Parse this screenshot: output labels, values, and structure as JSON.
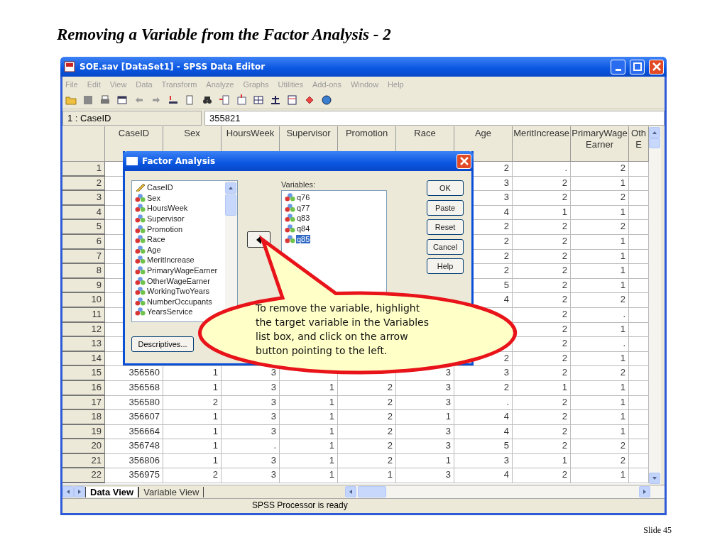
{
  "slide": {
    "title": "Removing a Variable from the Factor Analysis - 2",
    "footer": "Slide 45"
  },
  "window": {
    "title": "SOE.sav [DataSet1] - SPSS Data Editor"
  },
  "menu": [
    "File",
    "Edit",
    "View",
    "Data",
    "Transform",
    "Analyze",
    "Graphs",
    "Utilities",
    "Add-ons",
    "Window",
    "Help"
  ],
  "cell_editor": {
    "cell": "1 : CaseID",
    "value": "355821"
  },
  "table": {
    "columns": [
      "CaseID",
      "Sex",
      "HoursWeek",
      "Supervisor",
      "Promotion",
      "Race",
      "Age",
      "MeritIncrease",
      "PrimaryWageEarner",
      "Oth E"
    ],
    "rows": [
      {
        "number": "1",
        "cells": [
          null,
          null,
          null,
          null,
          null,
          null,
          "2",
          ".",
          "2"
        ]
      },
      {
        "number": "2",
        "cells": [
          null,
          null,
          null,
          null,
          null,
          null,
          "3",
          "2",
          "1"
        ]
      },
      {
        "number": "3",
        "cells": [
          null,
          null,
          null,
          null,
          null,
          null,
          "3",
          "2",
          "2"
        ]
      },
      {
        "number": "4",
        "cells": [
          null,
          null,
          null,
          null,
          null,
          null,
          "4",
          "1",
          "1"
        ]
      },
      {
        "number": "5",
        "cells": [
          null,
          null,
          null,
          null,
          null,
          null,
          "2",
          "2",
          "2"
        ]
      },
      {
        "number": "6",
        "cells": [
          null,
          null,
          null,
          null,
          null,
          null,
          "2",
          "2",
          "1"
        ]
      },
      {
        "number": "7",
        "cells": [
          null,
          null,
          null,
          null,
          null,
          null,
          "2",
          "2",
          "1"
        ]
      },
      {
        "number": "8",
        "cells": [
          null,
          null,
          null,
          null,
          null,
          null,
          "2",
          "2",
          "1"
        ]
      },
      {
        "number": "9",
        "cells": [
          null,
          null,
          null,
          null,
          null,
          null,
          "5",
          "2",
          "1"
        ]
      },
      {
        "number": "10",
        "cells": [
          null,
          null,
          null,
          null,
          null,
          null,
          "4",
          "2",
          "2"
        ]
      },
      {
        "number": "11",
        "cells": [
          null,
          null,
          null,
          null,
          null,
          null,
          null,
          "2",
          "."
        ]
      },
      {
        "number": "12",
        "cells": [
          null,
          null,
          null,
          null,
          null,
          null,
          null,
          "2",
          "1"
        ]
      },
      {
        "number": "13",
        "cells": [
          null,
          null,
          null,
          null,
          null,
          null,
          null,
          "2",
          "."
        ]
      },
      {
        "number": "14",
        "cells": [
          null,
          null,
          null,
          null,
          null,
          null,
          "2",
          "2",
          "1"
        ]
      },
      {
        "number": "15",
        "cells": [
          "356560",
          "1",
          "3",
          null,
          null,
          "3",
          "3",
          "2",
          "2"
        ]
      },
      {
        "number": "16",
        "cells": [
          "356568",
          "1",
          "3",
          "1",
          "2",
          "3",
          "2",
          "1",
          "1"
        ]
      },
      {
        "number": "17",
        "cells": [
          "356580",
          "2",
          "3",
          "1",
          "2",
          "3",
          ".",
          "2",
          "1"
        ]
      },
      {
        "number": "18",
        "cells": [
          "356607",
          "1",
          "3",
          "1",
          "2",
          "1",
          "4",
          "2",
          "1"
        ]
      },
      {
        "number": "19",
        "cells": [
          "356664",
          "1",
          "3",
          "1",
          "2",
          "3",
          "4",
          "2",
          "1"
        ]
      },
      {
        "number": "20",
        "cells": [
          "356748",
          "1",
          ".",
          "1",
          "2",
          "3",
          "5",
          "2",
          "2"
        ]
      },
      {
        "number": "21",
        "cells": [
          "356806",
          "1",
          "3",
          "1",
          "2",
          "1",
          "3",
          "1",
          "2"
        ]
      },
      {
        "number": "22",
        "cells": [
          "356975",
          "2",
          "3",
          "1",
          "1",
          "3",
          "4",
          "2",
          "1"
        ]
      }
    ]
  },
  "tabs": [
    {
      "label": "Data View",
      "selected": true
    },
    {
      "label": "Variable View",
      "selected": false
    }
  ],
  "status_bar": "SPSS Processor is ready",
  "dialog": {
    "title": "Factor Analysis",
    "source_list": [
      {
        "label": "CaseID",
        "kind": "scale"
      },
      {
        "label": "Sex",
        "kind": "nominal"
      },
      {
        "label": "HoursWeek",
        "kind": "nominal"
      },
      {
        "label": "Supervisor",
        "kind": "nominal"
      },
      {
        "label": "Promotion",
        "kind": "nominal"
      },
      {
        "label": "Race",
        "kind": "nominal"
      },
      {
        "label": "Age",
        "kind": "nominal"
      },
      {
        "label": "MeritIncrease",
        "kind": "nominal"
      },
      {
        "label": "PrimaryWageEarner",
        "kind": "nominal"
      },
      {
        "label": "OtherWageEarner",
        "kind": "nominal"
      },
      {
        "label": "WorkingTwoYears",
        "kind": "nominal"
      },
      {
        "label": "NumberOccupants",
        "kind": "nominal"
      },
      {
        "label": "YearsService",
        "kind": "nominal"
      }
    ],
    "variables_label": "Variables:",
    "variables": [
      {
        "label": "q76",
        "selected": false
      },
      {
        "label": "q77",
        "selected": false
      },
      {
        "label": "q83",
        "selected": false
      },
      {
        "label": "q84",
        "selected": false
      },
      {
        "label": "q85",
        "selected": true
      }
    ],
    "buttons": [
      "OK",
      "Paste",
      "Reset",
      "Cancel",
      "Help"
    ],
    "bottom_buttons": [
      "Descriptives..."
    ]
  },
  "callout": "To remove the variable, highlight the target variable in the Variables list box, and click on the arrow button pointing to the left."
}
